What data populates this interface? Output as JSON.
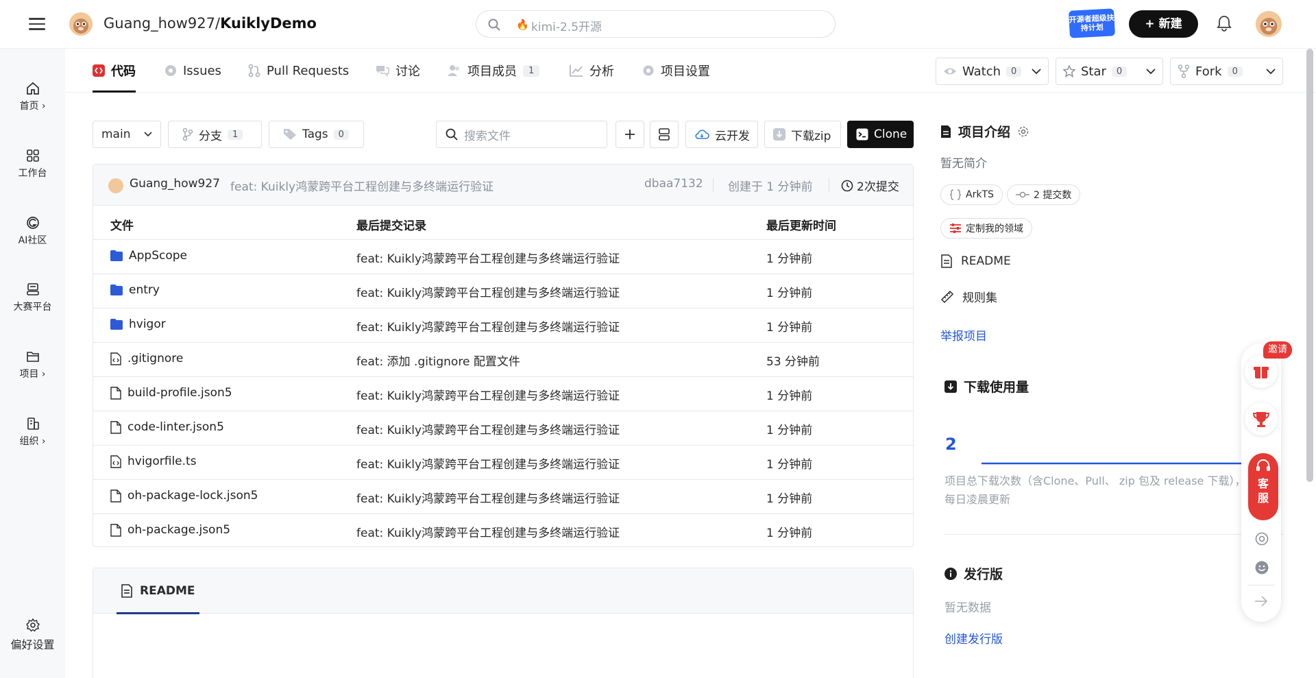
{
  "header": {
    "repo_owner": "Guang_how927/",
    "repo_name": "KuiklyDemo",
    "search_placeholder": "kimi-2.5开源",
    "promo_text": "开源者超级扶持计划",
    "new_button": "+ 新建"
  },
  "sidebar": {
    "items": [
      {
        "label": "首页 ›",
        "icon": "home-icon"
      },
      {
        "label": "工作台",
        "icon": "grid-icon"
      },
      {
        "label": "AI社区",
        "icon": "ai-community-icon"
      },
      {
        "label": "大赛平台",
        "icon": "contest-icon"
      },
      {
        "label": "项目 ›",
        "icon": "folder-icon"
      },
      {
        "label": "组织 ›",
        "icon": "org-icon"
      }
    ],
    "settings_label": "偏好设置"
  },
  "tabs": [
    {
      "label": "代码",
      "icon": "code-icon",
      "active": true
    },
    {
      "label": "Issues",
      "icon": "issues-icon"
    },
    {
      "label": "Pull Requests",
      "icon": "pull-request-icon"
    },
    {
      "label": "讨论",
      "icon": "discussion-icon"
    },
    {
      "label": "项目成员",
      "icon": "members-icon",
      "count": "1"
    },
    {
      "label": "分析",
      "icon": "analytics-icon"
    },
    {
      "label": "项目设置",
      "icon": "settings-icon"
    }
  ],
  "repo_actions": {
    "watch": {
      "label": "Watch",
      "count": "0"
    },
    "star": {
      "label": "Star",
      "count": "0"
    },
    "fork": {
      "label": "Fork",
      "count": "0"
    }
  },
  "toolbar": {
    "branch": "main",
    "branches": {
      "label": "分支",
      "count": "1"
    },
    "tags": {
      "label": "Tags",
      "count": "0"
    },
    "file_search_placeholder": "搜索文件",
    "cloud_dev": "云开发",
    "download_zip": "下载zip",
    "clone": "Clone"
  },
  "last_commit": {
    "user": "Guang_how927",
    "message": "feat: Kuikly鸿蒙跨平台工程创建与多终端运行验证",
    "hash": "dbaa7132",
    "created": "创建于 1 分钟前",
    "commit_count": "2次提交"
  },
  "file_table": {
    "headers": [
      "文件",
      "最后提交记录",
      "最后更新时间"
    ],
    "rows": [
      {
        "name": "AppScope",
        "type": "folder",
        "message": "feat: Kuikly鸿蒙跨平台工程创建与多终端运行验证",
        "time": "1 分钟前"
      },
      {
        "name": "entry",
        "type": "folder",
        "message": "feat: Kuikly鸿蒙跨平台工程创建与多终端运行验证",
        "time": "1 分钟前"
      },
      {
        "name": "hvigor",
        "type": "folder",
        "message": "feat: Kuikly鸿蒙跨平台工程创建与多终端运行验证",
        "time": "1 分钟前"
      },
      {
        "name": ".gitignore",
        "type": "code-file",
        "message": "feat: 添加 .gitignore 配置文件",
        "time": "53 分钟前"
      },
      {
        "name": "build-profile.json5",
        "type": "file",
        "message": "feat: Kuikly鸿蒙跨平台工程创建与多终端运行验证",
        "time": "1 分钟前"
      },
      {
        "name": "code-linter.json5",
        "type": "file",
        "message": "feat: Kuikly鸿蒙跨平台工程创建与多终端运行验证",
        "time": "1 分钟前"
      },
      {
        "name": "hvigorfile.ts",
        "type": "code-file",
        "message": "feat: Kuikly鸿蒙跨平台工程创建与多终端运行验证",
        "time": "1 分钟前"
      },
      {
        "name": "oh-package-lock.json5",
        "type": "file",
        "message": "feat: Kuikly鸿蒙跨平台工程创建与多终端运行验证",
        "time": "1 分钟前"
      },
      {
        "name": "oh-package.json5",
        "type": "file",
        "message": "feat: Kuikly鸿蒙跨平台工程创建与多终端运行验证",
        "time": "1 分钟前"
      }
    ]
  },
  "readme": {
    "tab_label": "README"
  },
  "right_panel": {
    "intro_title": "项目介绍",
    "intro_text": "暂无简介",
    "language_pill": "ArkTS",
    "commits_pill": "2 提交数",
    "domain_pill": "定制我的领域",
    "readme_link": "README",
    "rules_link": "规则集",
    "report_link": "举报项目",
    "downloads_title": "下载使用量",
    "downloads_count": "2",
    "downloads_note": "项目总下载次数（含Clone、Pull、 zip 包及 release 下载），每日凌晨更新",
    "release_title": "发行版",
    "release_empty": "暂无数据",
    "create_release": "创建发行版"
  },
  "float_widget": {
    "invite": "邀请",
    "customer_service": "客服"
  },
  "colors": {
    "accent_red": "#e03131",
    "link_blue": "#2356d8",
    "folder_blue": "#2d5bd7",
    "dark": "#111111"
  }
}
